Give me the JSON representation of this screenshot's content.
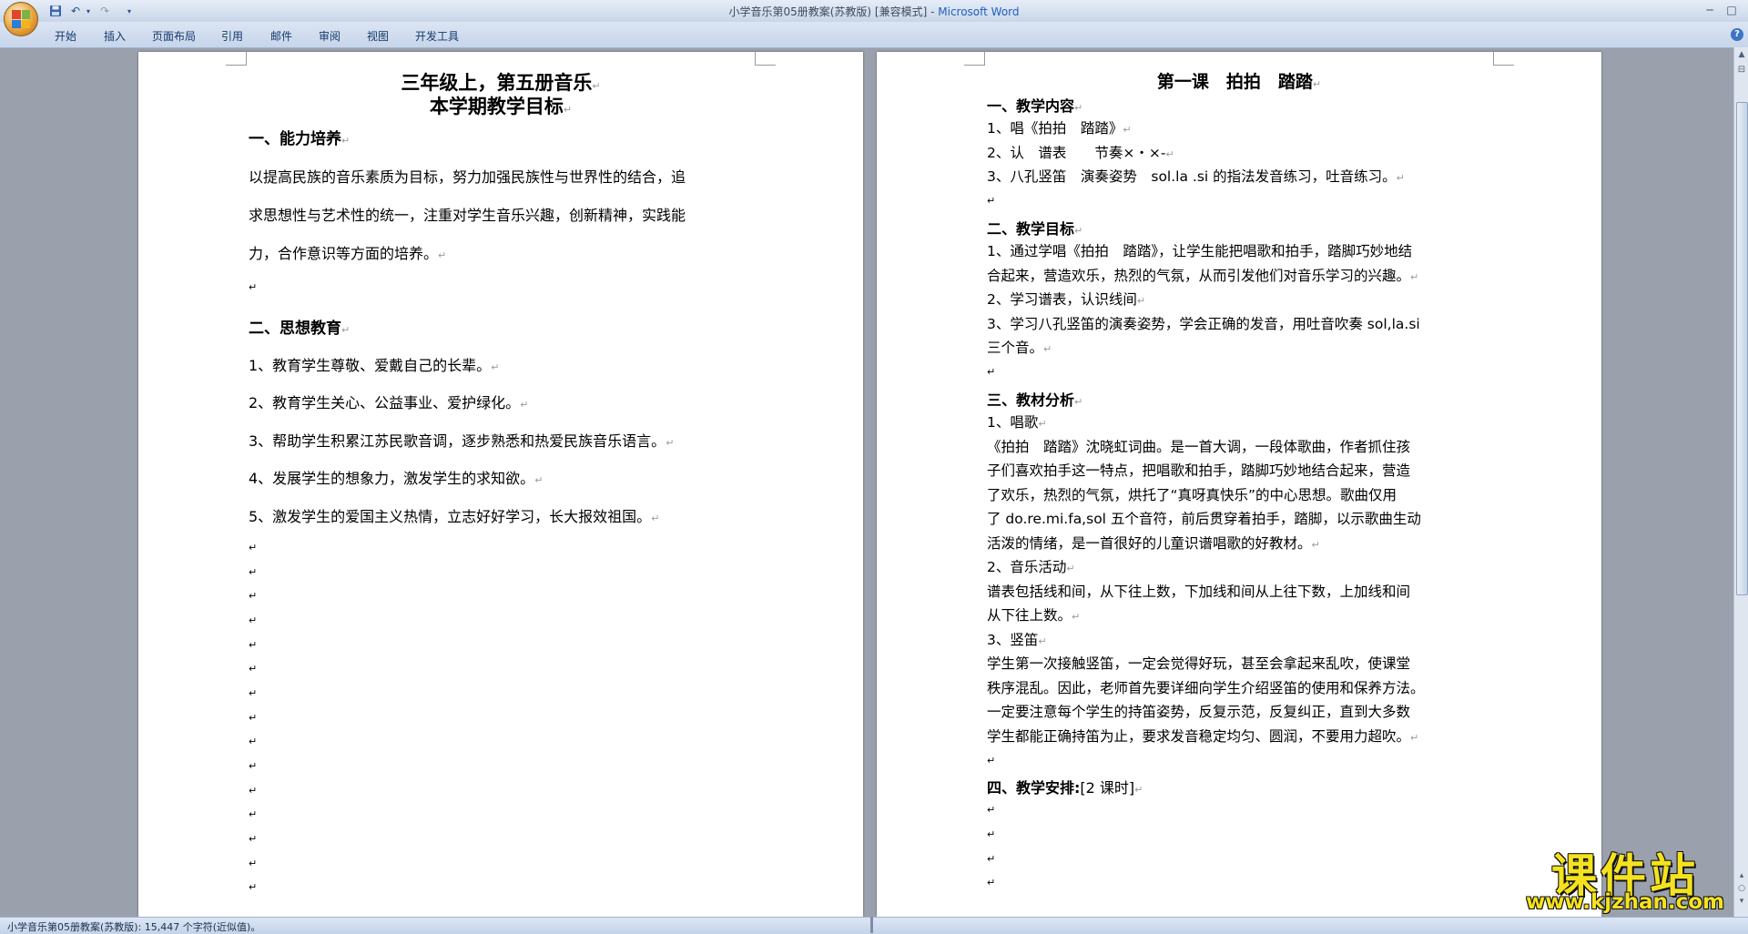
{
  "window": {
    "title_doc": "小学音乐第05册教案(苏教版) [兼容模式] - ",
    "title_app": "Microsoft Word"
  },
  "ribbon_tabs": [
    "开始",
    "插入",
    "页面布局",
    "引用",
    "邮件",
    "审阅",
    "视图",
    "开发工具"
  ],
  "page_left": {
    "title1": "三年级上，第五册音乐",
    "title2": "本学期教学目标",
    "h1": "一、能力培养",
    "p1_l1": "以提高民族的音乐素质为目标，努力加强民族性与世界性的结合，追",
    "p1_l2": "求思想性与艺术性的统一，注重对学生音乐兴趣，创新精神，实践能",
    "p1_l3": "力，合作意识等方面的培养。",
    "h2": "二、思想教育",
    "items": [
      "1、教育学生尊敬、爱戴自己的长辈。",
      "2、教育学生关心、公益事业、爱护绿化。",
      "3、帮助学生积累江苏民歌音调，逐步熟悉和热爱民族音乐语言。",
      "4、发展学生的想象力，激发学生的求知欲。",
      "5、激发学生的爱国主义热情，立志好好学习，长大报效祖国。"
    ]
  },
  "page_right": {
    "title": "第一课　拍拍　踏踏",
    "h1": "一、教学内容",
    "c1": "1、唱《拍拍　踏踏》",
    "c2": "2、认　谱表　　节奏×・×-",
    "c3": "3、八孔竖笛　演奏姿势　sol.la .si 的指法发音练习，吐音练习。",
    "h2": "二、教学目标",
    "g1a": "1、通过学唱《拍拍　踏踏》，让学生能把唱歌和拍手，踏脚巧妙地结",
    "g1b": "合起来，营造欢乐，热烈的气氛，从而引发他们对音乐学习的兴趣。",
    "g2": "2、学习谱表，认识线间",
    "g3a": "3、学习八孔竖笛的演奏姿势，学会正确的发音，用吐音吹奏 sol,la.si",
    "g3b": "三个音。",
    "h3": "三、教材分析",
    "s1": "1、唱歌",
    "s1_l1": "《拍拍　踏踏》沈晓虹词曲。是一首大调，一段体歌曲，作者抓住孩",
    "s1_l2": "子们喜欢拍手这一特点，把唱歌和拍手，踏脚巧妙地结合起来，营造",
    "s1_l3": "了欢乐，热烈的气氛，烘托了“真呀真快乐”的中心思想。歌曲仅用",
    "s1_l4": "了 do.re.mi.fa,sol 五个音符，前后贯穿着拍手，踏脚，以示歌曲生动",
    "s1_l5": "活泼的情绪，是一首很好的儿童识谱唱歌的好教材。",
    "s2": "2、音乐活动",
    "s2_l1": "谱表包括线和间，从下往上数，下加线和间从上往下数，上加线和间",
    "s2_l2": "从下往上数。",
    "s3": "3、竖笛",
    "s3_l1": "学生第一次接触竖笛，一定会觉得好玩，甚至会拿起来乱吹，使课堂",
    "s3_l2": "秩序混乱。因此，老师首先要详细向学生介绍竖笛的使用和保养方法。",
    "s3_l3": "一定要注意每个学生的持笛姿势，反复示范，反复纠正，直到大多数",
    "s3_l4": "学生都能正确持笛为止，要求发音稳定均匀、圆润，不要用力超吹。",
    "h4": "四、教学安排:",
    "h4_val": "[2 课时]"
  },
  "status": {
    "text": "小学音乐第05册教案(苏教版): 15,447 个字符(近似值)。"
  },
  "watermark": {
    "cn": "课件站",
    "url": "www.kjzhan.com"
  },
  "icons": {
    "office_button": "office-logo-icon",
    "save": "save-icon",
    "undo": "undo-icon",
    "redo": "redo-icon",
    "help": "help-icon",
    "paragraph_mark": "↵"
  }
}
